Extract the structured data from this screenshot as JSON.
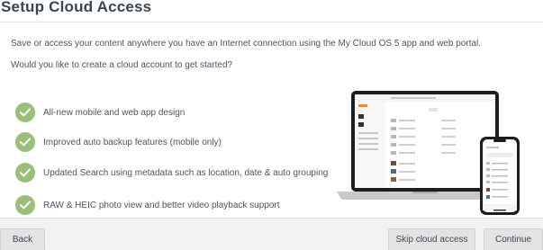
{
  "header": {
    "title": "Setup Cloud Access"
  },
  "intro": {
    "line1": "Save or access your content anywhere you have an Internet connection using the My Cloud OS 5 app and web portal.",
    "line2": "Would you like to create a cloud account to get started?"
  },
  "features": [
    {
      "label": "All-new mobile and web app design",
      "icon": "check-icon"
    },
    {
      "label": "Improved auto backup features (mobile only)",
      "icon": "check-icon"
    },
    {
      "label": "Updated Search using metadata such as location, date & auto grouping",
      "icon": "check-icon"
    },
    {
      "label": "RAW & HEIC photo view and better video playback support",
      "icon": "check-icon"
    }
  ],
  "colors": {
    "check": "#9bbf78",
    "footer": "#f2f2f2",
    "button": "#e3e3e3"
  },
  "footer": {
    "back_label": "Back",
    "skip_label": "Skip cloud access",
    "continue_label": "Continue"
  }
}
